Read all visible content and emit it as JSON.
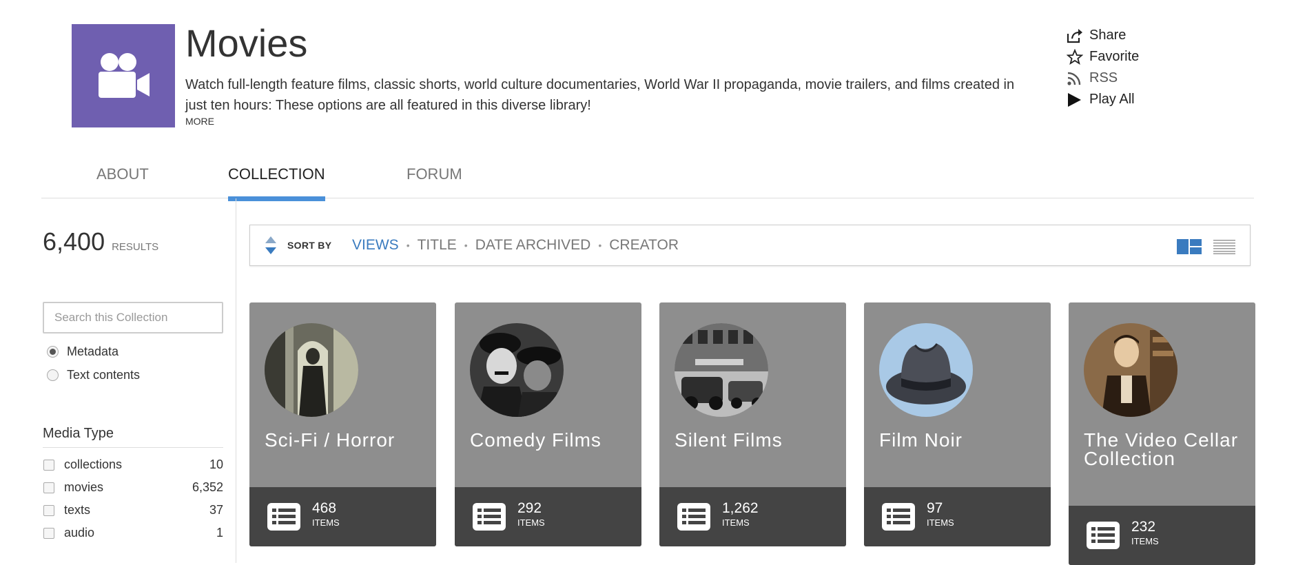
{
  "header": {
    "title": "Movies",
    "description": "Watch full-length feature films, classic shorts, world culture documentaries, World War II propaganda, movie trailers, and films created in just ten hours: These options are all featured in this diverse library!",
    "more_label": "MORE",
    "logo_icon": "movie-camera-icon",
    "logo_color": "#6f5fb0"
  },
  "actions": [
    {
      "label": "Share",
      "icon": "share-icon"
    },
    {
      "label": "Favorite",
      "icon": "star-icon"
    },
    {
      "label": "RSS",
      "icon": "rss-icon"
    },
    {
      "label": "Play All",
      "icon": "play-icon"
    }
  ],
  "tabs": [
    {
      "label": "ABOUT",
      "active": false
    },
    {
      "label": "COLLECTION",
      "active": true
    },
    {
      "label": "FORUM",
      "active": false
    }
  ],
  "accent_color": "#4a90d9",
  "sidebar": {
    "results_count": "6,400",
    "results_label": "RESULTS",
    "search_placeholder": "Search this Collection",
    "search_value": "",
    "search_options": [
      {
        "label": "Metadata",
        "selected": true
      },
      {
        "label": "Text contents",
        "selected": false
      }
    ],
    "facet_title": "Media Type",
    "facets": [
      {
        "name": "collections",
        "count": "10"
      },
      {
        "name": "movies",
        "count": "6,352"
      },
      {
        "name": "texts",
        "count": "37"
      },
      {
        "name": "audio",
        "count": "1"
      }
    ]
  },
  "sortbar": {
    "label": "SORT BY",
    "options": [
      "VIEWS",
      "TITLE",
      "DATE ARCHIVED",
      "CREATOR"
    ],
    "active_option": "VIEWS"
  },
  "cards": [
    {
      "title": "Sci-Fi / Horror",
      "count": "468",
      "items_label": "ITEMS"
    },
    {
      "title": "Comedy Films",
      "count": "292",
      "items_label": "ITEMS"
    },
    {
      "title": "Silent Films",
      "count": "1,262",
      "items_label": "ITEMS"
    },
    {
      "title": "Film Noir",
      "count": "97",
      "items_label": "ITEMS"
    },
    {
      "title": "The Video Cellar Collection",
      "count": "232",
      "items_label": "ITEMS"
    }
  ]
}
